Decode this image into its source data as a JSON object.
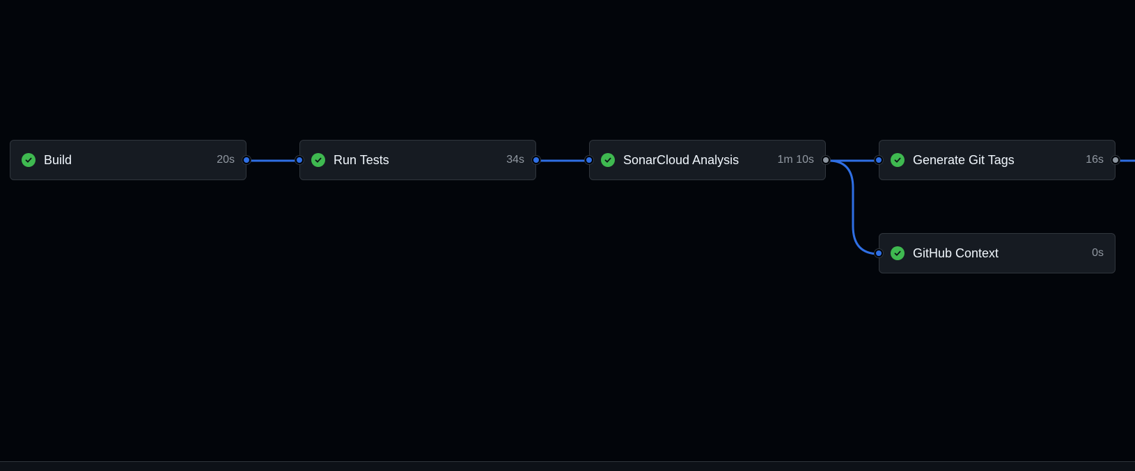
{
  "workflow": {
    "jobs": [
      {
        "id": "build",
        "name": "Build",
        "duration": "20s",
        "status": "success"
      },
      {
        "id": "run-tests",
        "name": "Run Tests",
        "duration": "34s",
        "status": "success"
      },
      {
        "id": "sonarcloud",
        "name": "SonarCloud Analysis",
        "duration": "1m 10s",
        "status": "success"
      },
      {
        "id": "git-tags",
        "name": "Generate Git Tags",
        "duration": "16s",
        "status": "success"
      },
      {
        "id": "github-context",
        "name": "GitHub Context",
        "duration": "0s",
        "status": "success"
      }
    ],
    "colors": {
      "background": "#010409",
      "card": "#161b22",
      "card_border": "#30363d",
      "success": "#3fb950",
      "edge": "#2f6fe4",
      "text": "#f0f6fc",
      "muted": "#9198a1"
    },
    "icons": {
      "status": "check-circle-icon"
    }
  }
}
